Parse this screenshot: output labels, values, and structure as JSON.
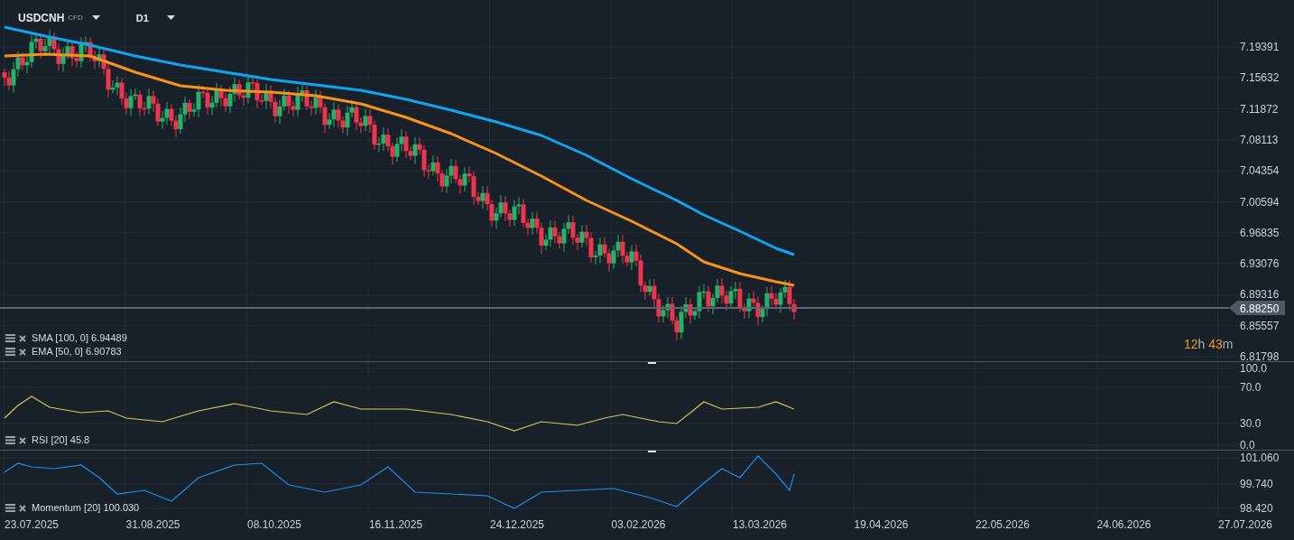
{
  "header": {
    "symbol": "USDCNH",
    "instrument_type": "CFD",
    "timeframe": "D1"
  },
  "main_pane": {
    "legends": [
      {
        "text": "SMA [100, 0] 6.94489",
        "color": "#0ea5f0"
      },
      {
        "text": "EMA [50, 0] 6.90783",
        "color": "#f7931a"
      }
    ],
    "y_axis": [
      "7.19391",
      "7.15632",
      "7.11872",
      "7.08113",
      "7.04354",
      "7.00594",
      "6.96835",
      "6.93076",
      "6.89316",
      "6.85557",
      "6.81798"
    ],
    "current_price": "6.88250",
    "countdown": [
      {
        "text": "12",
        "kind": "number"
      },
      {
        "text": "h",
        "kind": "unit"
      },
      {
        "text": " 43",
        "kind": "number"
      },
      {
        "text": "m",
        "kind": "unit"
      }
    ]
  },
  "rsi_pane": {
    "legend": "RSI [20] 45.8",
    "y_axis": [
      "100.0",
      "70.0",
      "30.0",
      "0.0"
    ]
  },
  "momentum_pane": {
    "legend": "Momentum [20] 100.030",
    "y_axis": [
      "101.060",
      "99.740",
      "98.420"
    ]
  },
  "x_axis": [
    "23.07.2025",
    "31.08.2025",
    "08.10.2025",
    "16.11.2025",
    "24.12.2025",
    "03.02.2026",
    "13.03.2026",
    "19.04.2026",
    "22.05.2026",
    "24.06.2026",
    "27.07.2026"
  ]
}
